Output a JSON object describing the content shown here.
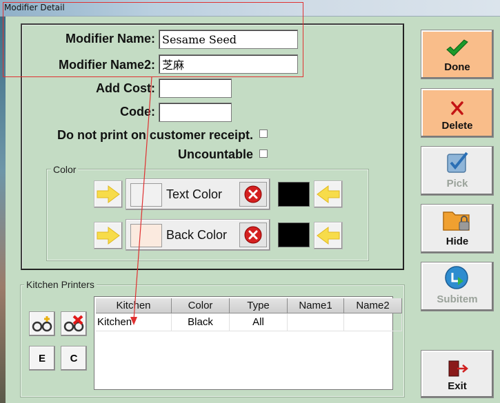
{
  "window": {
    "title": "Modifier Detail"
  },
  "form": {
    "modifier_name_label": "Modifier Name:",
    "modifier_name_value": "Sesame Seed",
    "modifier_name2_label": "Modifier Name2:",
    "modifier_name2_value": "芝麻",
    "add_cost_label": "Add Cost:",
    "add_cost_value": "",
    "code_label": "Code:",
    "code_value": "",
    "no_print_label": "Do not print on customer receipt.",
    "uncountable_label": "Uncountable"
  },
  "color_group": {
    "legend": "Color",
    "text_color_label": "Text Color",
    "back_color_label": "Back Color",
    "text_color_swatch": "#f1f1f1",
    "back_color_swatch": "#fbeadf",
    "text_color_preview": "#000000",
    "back_color_preview": "#000000"
  },
  "kitchen": {
    "legend": "Kitchen Printers",
    "e_label": "E",
    "c_label": "C",
    "columns": [
      "Kitchen",
      "Color",
      "Type",
      "Name1",
      "Name2"
    ],
    "rows": [
      {
        "kitchen": "Kitchen",
        "color": "Black",
        "type": "All",
        "name1": "",
        "name2": ""
      }
    ]
  },
  "side_buttons": {
    "done": "Done",
    "delete": "Delete",
    "pick": "Pick",
    "hide": "Hide",
    "subitem": "Subitem",
    "exit": "Exit"
  },
  "colors": {
    "background": "#c4dcc4",
    "accent_orange": "#f9bd8a",
    "annotation_red": "#e03030"
  }
}
